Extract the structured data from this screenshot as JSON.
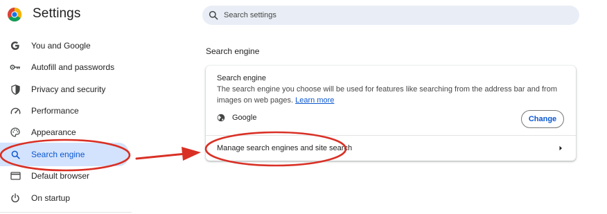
{
  "header": {
    "title": "Settings",
    "search_placeholder": "Search settings"
  },
  "sidebar": {
    "items": [
      {
        "label": "You and Google",
        "icon": "google-g-icon",
        "active": false
      },
      {
        "label": "Autofill and passwords",
        "icon": "key-icon",
        "active": false
      },
      {
        "label": "Privacy and security",
        "icon": "shield-icon",
        "active": false
      },
      {
        "label": "Performance",
        "icon": "speedometer-icon",
        "active": false
      },
      {
        "label": "Appearance",
        "icon": "palette-icon",
        "active": false
      },
      {
        "label": "Search engine",
        "icon": "search-icon",
        "active": true
      },
      {
        "label": "Default browser",
        "icon": "browser-window-icon",
        "active": false
      },
      {
        "label": "On startup",
        "icon": "power-icon",
        "active": false
      }
    ]
  },
  "main": {
    "section_title": "Search engine",
    "card": {
      "heading": "Search engine",
      "description": "The search engine you choose will be used for features like searching from the address bar and from images on web pages.",
      "learn_more": "Learn more",
      "engine_name": "Google",
      "engine_icon": "globe-icon",
      "change_label": "Change",
      "manage_label": "Manage search engines and site search",
      "manage_icon": "chevron-right-icon"
    }
  },
  "annotation": {
    "color": "#d93025",
    "shapes": [
      "ellipse-around-search-engine-nav",
      "arrow",
      "ellipse-around-manage-row"
    ]
  },
  "colors": {
    "accent": "#0b57d0",
    "active_bg": "#d3e3fd",
    "search_bg": "#e9eef6"
  }
}
